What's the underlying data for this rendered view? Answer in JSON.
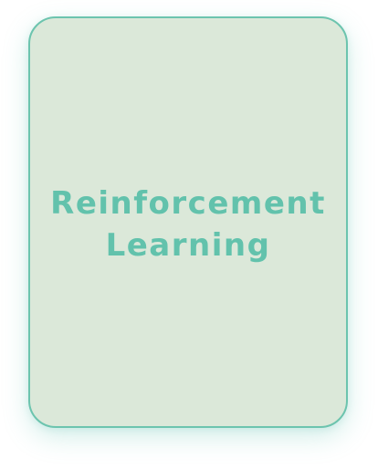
{
  "card": {
    "title_line1": "Reinforcement",
    "title_line2": "Learning"
  },
  "colors": {
    "card_background": "#dbe8d9",
    "card_border": "#6cc4ae",
    "title_text": "#62c2ac"
  }
}
